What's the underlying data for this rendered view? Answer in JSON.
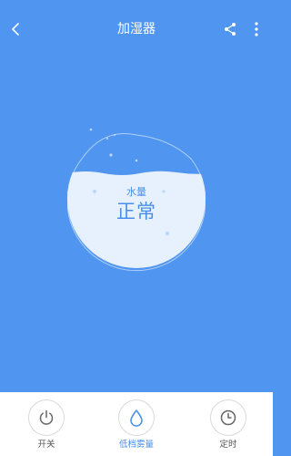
{
  "header": {
    "title": "加湿器"
  },
  "tank": {
    "label": "水量",
    "status": "正常"
  },
  "controls": [
    {
      "label": "开关",
      "icon": "power-icon",
      "active": false
    },
    {
      "label": "低档雾量",
      "icon": "water-drop-icon",
      "active": true
    },
    {
      "label": "定时",
      "icon": "clock-icon",
      "active": false
    }
  ],
  "colors": {
    "background": "#5096f0",
    "accent": "#4a8fe6",
    "tank_fill": "#e6f1fd",
    "icon_gray": "#666666"
  }
}
